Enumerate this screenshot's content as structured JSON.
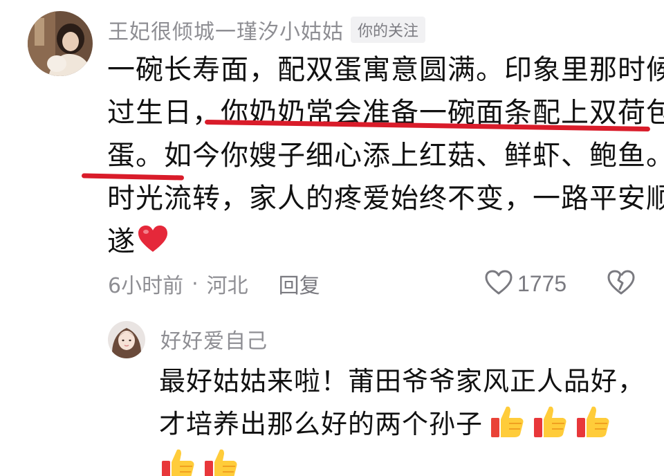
{
  "comment": {
    "author": "王妃很倾城一瑾汐小姑姑",
    "follow_badge": "你的关注",
    "lines": [
      "一碗长寿面，配双蛋寓意圆满。印象里那时候",
      "过生日，你奶奶常会准备一碗面条配上双荷包",
      "蛋。如今你嫂子细心添上红菇、鲜虾、鲍鱼。",
      "时光流转，家人的疼爱始终不变，一路平安顺",
      "遂"
    ],
    "emoji_after_text": "heart-emoji",
    "time": "6小时前",
    "separator": "·",
    "location": "河北",
    "reply_label": "回复",
    "like_count": "1775",
    "icons": {
      "like": "heart-outline-icon",
      "dislike": "broken-heart-icon"
    },
    "underline_color": "#d91c2a"
  },
  "reply": {
    "author": "好好爱自己",
    "lines": [
      "最好姑姑来啦！莆田爷爷家风正人品好，",
      "才培养出那么好的两个孙子"
    ],
    "emoji": "thumbs-up-emoji",
    "emoji_count_line2": 3,
    "emoji_count_line3": 2
  }
}
